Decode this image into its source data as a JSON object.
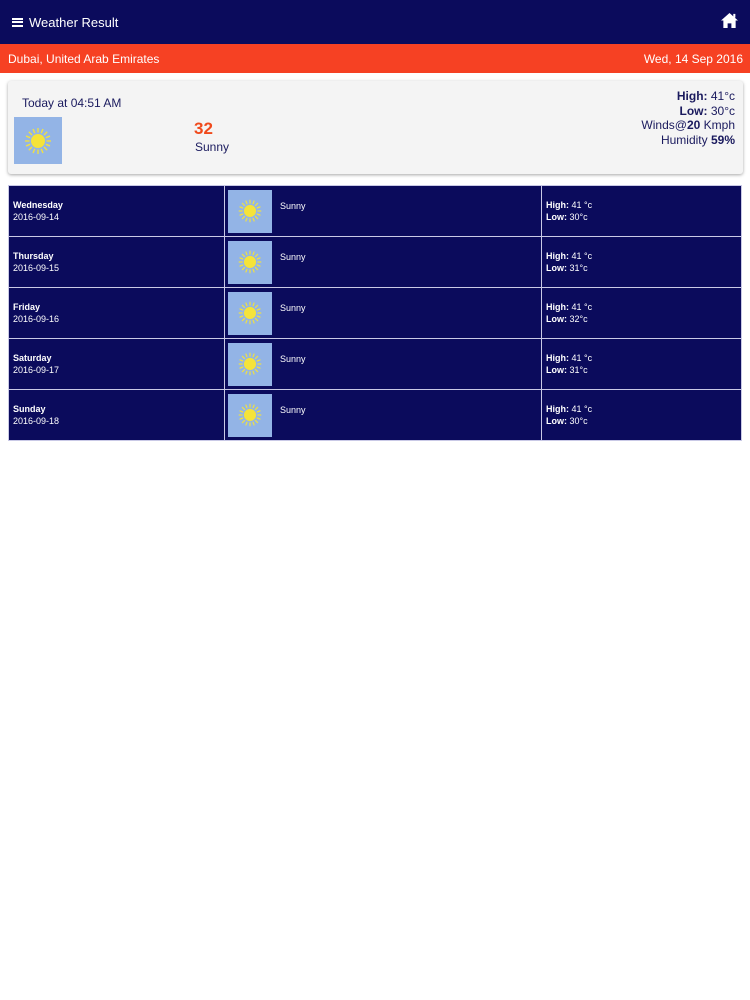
{
  "header": {
    "title": "Weather Result",
    "menu_icon": "menu-icon",
    "home_icon": "home-icon"
  },
  "location_bar": {
    "location": "Dubai, United Arab Emirates",
    "date": "Wed, 14 Sep 2016"
  },
  "today": {
    "time_label": "Today at 04:51 AM",
    "icon": "sun-icon",
    "temperature": "32",
    "condition": "Sunny",
    "high_label": "High:",
    "high_value": " 41°c",
    "low_label": "Low:",
    "low_value": " 30°c",
    "winds_prefix": "Winds@",
    "winds_value": "20",
    "winds_unit": " Kmph",
    "humidity_label": "Humidity ",
    "humidity_value": "59%"
  },
  "forecast": {
    "high_label": "High:",
    "low_label": "Low:",
    "rows": [
      {
        "day": "Wednesday",
        "date": "2016-09-14",
        "condition": "Sunny",
        "high": " 41 °c",
        "low": " 30°c"
      },
      {
        "day": "Thursday",
        "date": "2016-09-15",
        "condition": "Sunny",
        "high": " 41 °c",
        "low": " 31°c"
      },
      {
        "day": "Friday",
        "date": "2016-09-16",
        "condition": "Sunny",
        "high": " 41 °c",
        "low": " 32°c"
      },
      {
        "day": "Saturday",
        "date": "2016-09-17",
        "condition": "Sunny",
        "high": " 41 °c",
        "low": " 31°c"
      },
      {
        "day": "Sunday",
        "date": "2016-09-18",
        "condition": "Sunny",
        "high": " 41 °c",
        "low": " 30°c"
      }
    ]
  },
  "colors": {
    "navy": "#0b0b5c",
    "accent_orange": "#f64123",
    "temperature": "#f04a1c",
    "icon_bg": "#93b4e6",
    "sun": "#f5e33a"
  }
}
